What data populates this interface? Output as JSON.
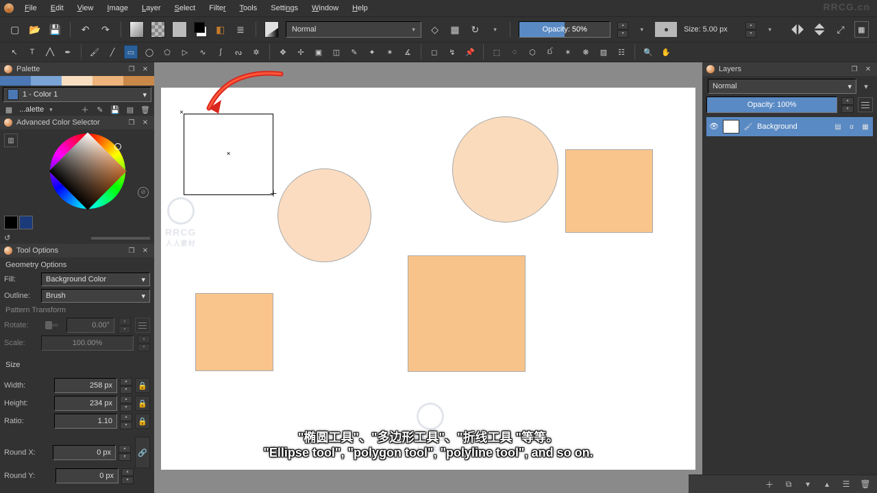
{
  "menu": {
    "items": [
      "File",
      "Edit",
      "View",
      "Image",
      "Layer",
      "Select",
      "Filter",
      "Tools",
      "Settings",
      "Window",
      "Help"
    ]
  },
  "watermark_top": "RRCG.cn",
  "toolbar": {
    "blend_mode": "Normal",
    "opacity_label": "Opacity: 50%",
    "size_label": "Size: 5.00 px"
  },
  "palette": {
    "title": "Palette",
    "colors": [
      "#4b78b5",
      "#7aa4d6",
      "#f9dfc2",
      "#eeb47b",
      "#c98848"
    ],
    "selected_label": "1 - Color 1",
    "selected_hex": "#4b78b5",
    "dropdown_label": "...alette"
  },
  "acs": {
    "title": "Advanced Color Selector"
  },
  "tool_options": {
    "title": "Tool Options",
    "geometry_heading": "Geometry Options",
    "fill_label": "Fill:",
    "fill_value": "Background Color",
    "outline_label": "Outline:",
    "outline_value": "Brush",
    "pattern_heading": "Pattern Transform",
    "rotate_label": "Rotate:",
    "rotate_value": "0.00°",
    "scale_label": "Scale:",
    "scale_value": "100.00%",
    "size_heading": "Size",
    "width_label": "Width:",
    "width_value": "258 px",
    "height_label": "Height:",
    "height_value": "234 px",
    "ratio_label": "Ratio:",
    "ratio_value": "1.10",
    "roundx_label": "Round X:",
    "roundx_value": "0 px",
    "roundy_label": "Round Y:",
    "roundy_value": "0 px"
  },
  "layers": {
    "title": "Layers",
    "blend_mode": "Normal",
    "opacity_label": "Opacity:  100%",
    "items": [
      {
        "name": "Background"
      }
    ]
  },
  "subtitle": {
    "line1": "\"椭圆工具\"、\"多边形工具\"、\"折线工具 \"等等。",
    "line2": "\"Ellipse tool\", \"polygon tool\", \"polyline tool\", and so on."
  },
  "canvas_watermark": {
    "brand": "RRCG",
    "sub": "人人素材"
  }
}
